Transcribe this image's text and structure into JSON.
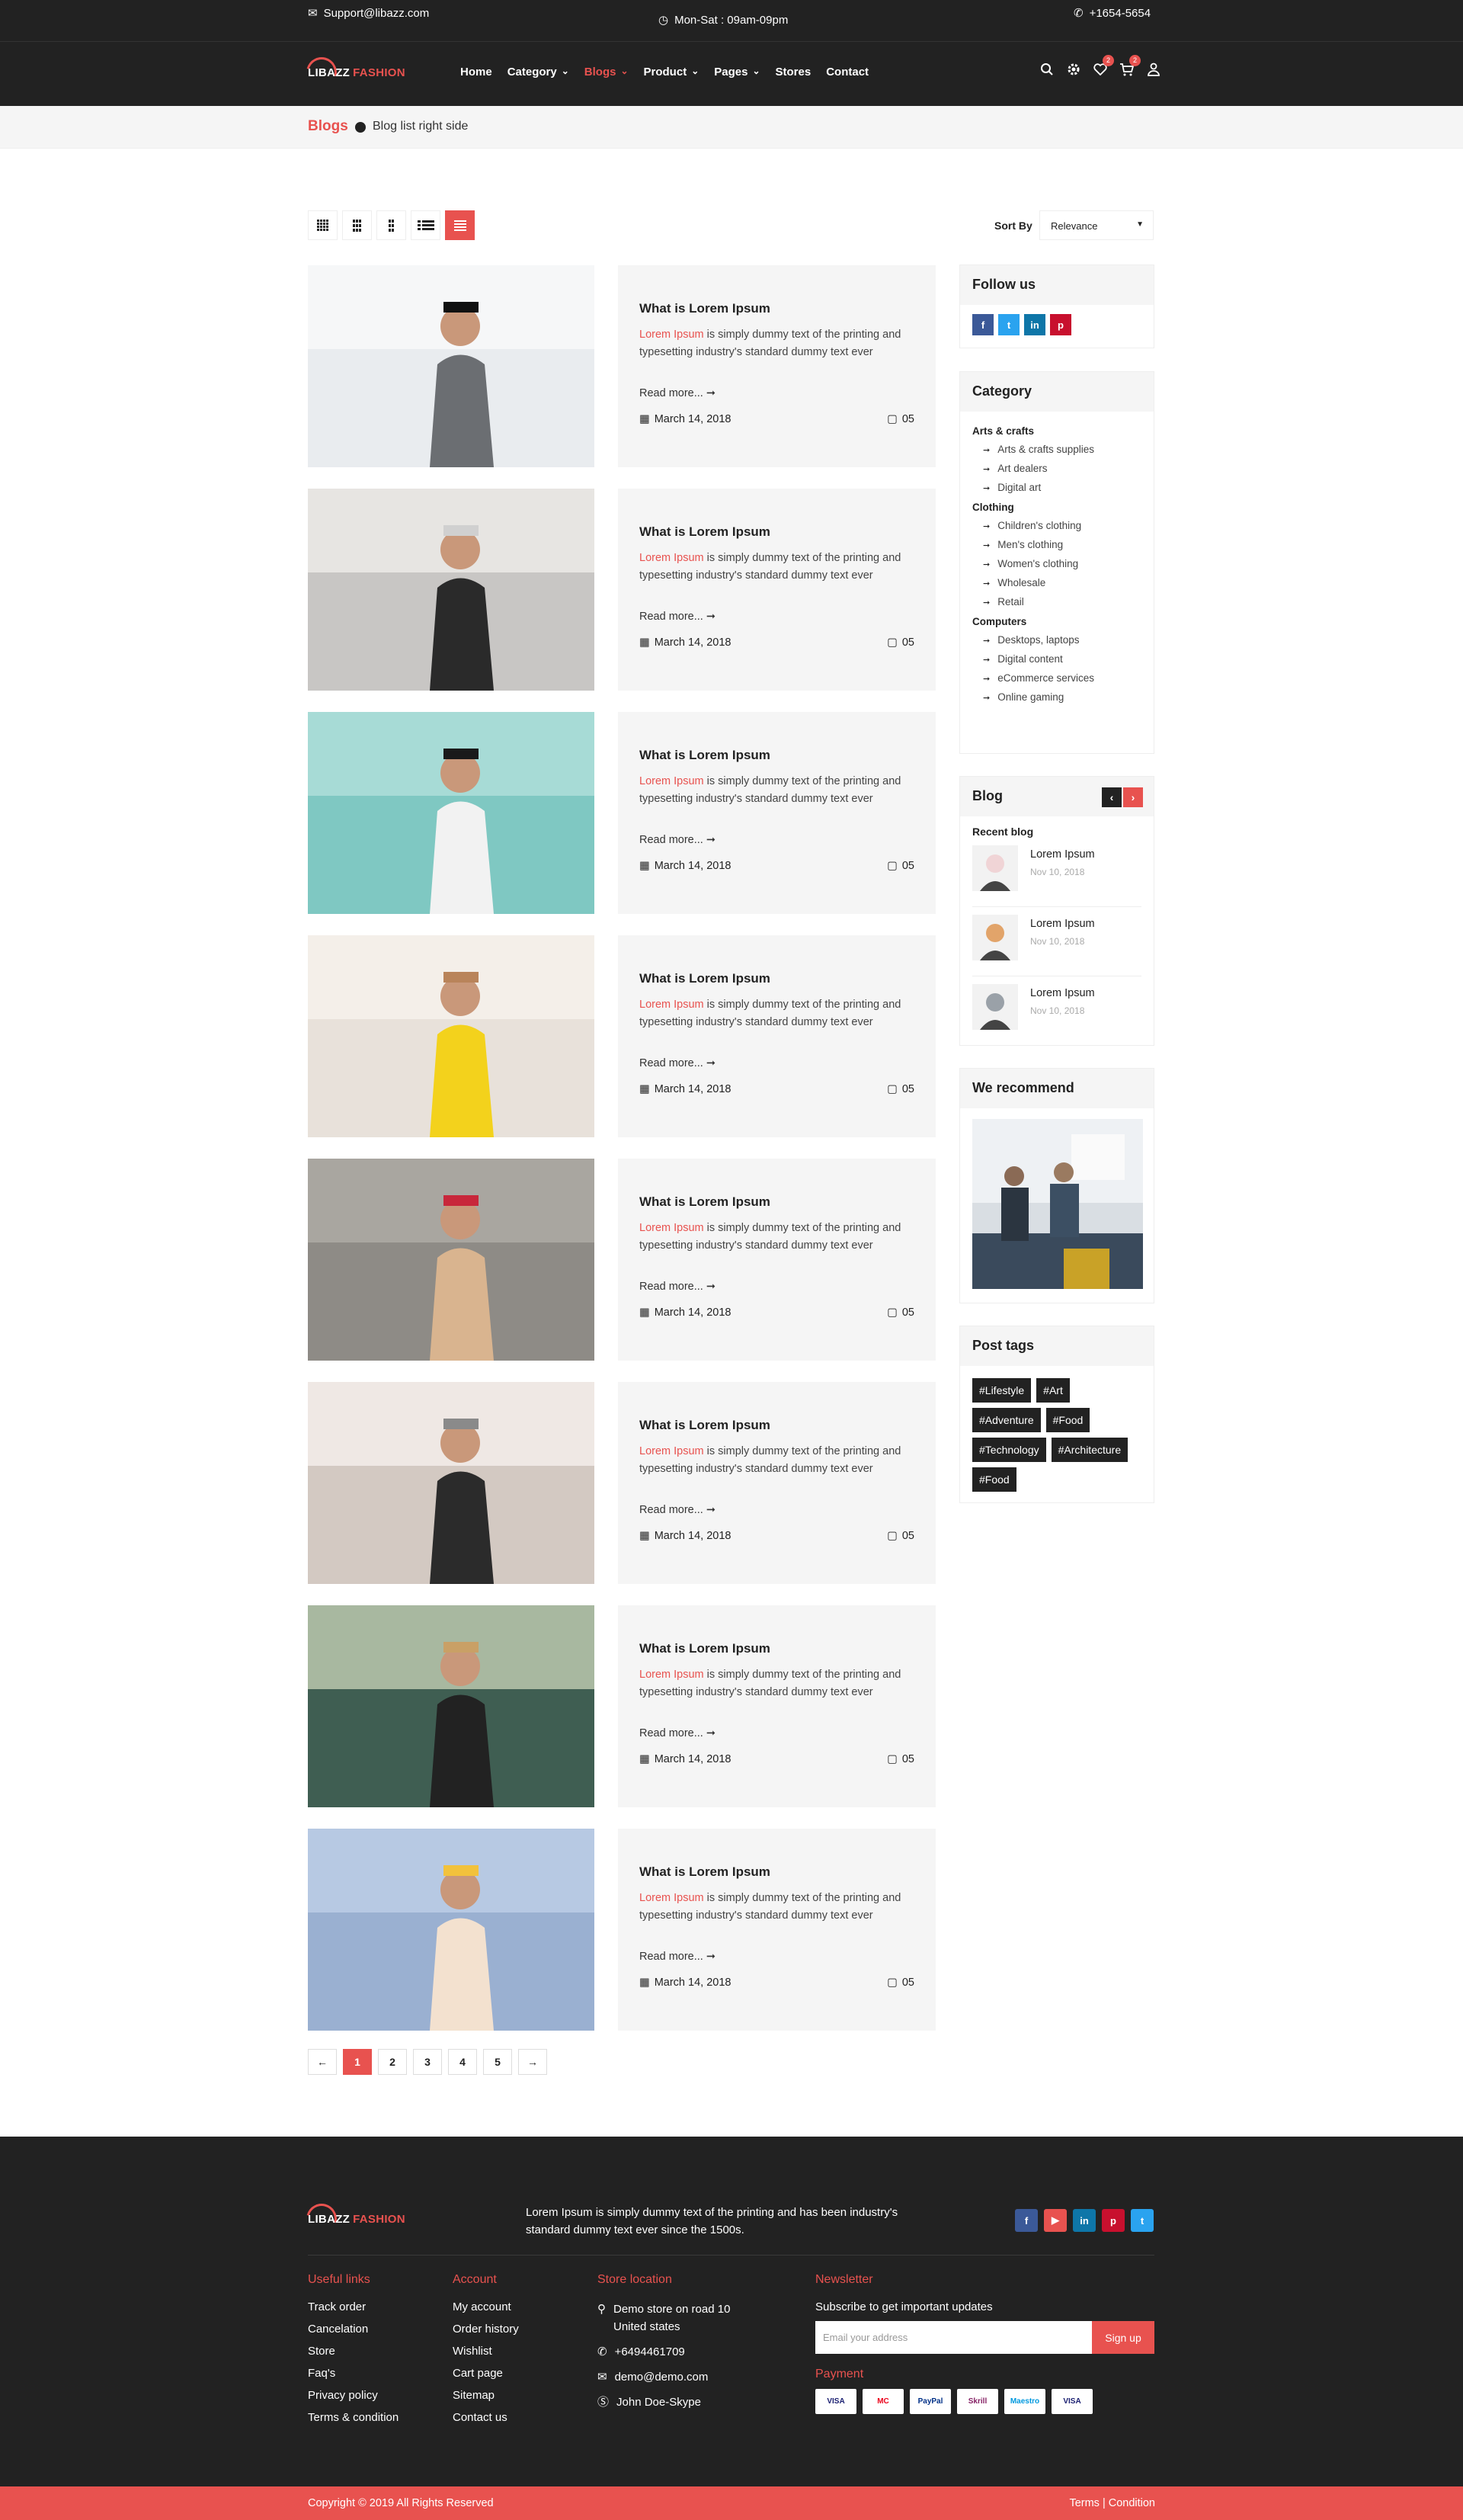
{
  "topbar": {
    "email": "Support@libazz.com",
    "hours": "Mon-Sat : 09am-09pm",
    "phone": "+1654-5654"
  },
  "brand": {
    "part1": "LIBAZZ",
    "part2": "FASHION"
  },
  "menu": [
    "Home",
    "Category",
    "Blogs",
    "Product",
    "Pages",
    "Stores",
    "Contact"
  ],
  "menu_dropdown": [
    "",
    "⌄",
    "⌄",
    "⌄",
    "⌄",
    "",
    ""
  ],
  "icons": {
    "wishlist_count": "2",
    "cart_count": "2"
  },
  "breadcrumb": {
    "section": "Blogs",
    "page": "Blog list right side"
  },
  "toolbar": {
    "sort_label": "Sort By",
    "sort_value": "Relevance"
  },
  "post": {
    "title": "What is Lorem Ipsum",
    "excerpt_hl": "Lorem Ipsum",
    "excerpt_rest": " is simply dummy text of the printing and typesetting industry's standard dummy text ever",
    "read_more": "Read more... ➞",
    "date": "March 14, 2018",
    "comments": "05"
  },
  "posts_count": 8,
  "sidebar": {
    "follow": "Follow us",
    "category": "Category",
    "category_groups": [
      {
        "name": "Arts & crafts",
        "items": [
          "Arts & crafts supplies",
          "Art dealers",
          "Digital art"
        ]
      },
      {
        "name": "Clothing",
        "items": [
          "Children's clothing",
          "Men's clothing",
          "Women's clothing",
          "Wholesale",
          "Retail"
        ]
      },
      {
        "name": "Computers",
        "items": [
          "Desktops, laptops",
          "Digital content",
          "eCommerce services",
          "Online gaming"
        ]
      }
    ],
    "blog": "Blog",
    "recent": "Recent blog",
    "recent_items": [
      {
        "title": "Lorem Ipsum",
        "date": "Nov 10, 2018"
      },
      {
        "title": "Lorem Ipsum",
        "date": "Nov 10, 2018"
      },
      {
        "title": "Lorem Ipsum",
        "date": "Nov 10, 2018"
      }
    ],
    "recommend": "We recommend",
    "tags_title": "Post tags",
    "tags": [
      "#Lifestyle",
      "#Art",
      "#Adventure",
      "#Food",
      "#Technology",
      "#Architecture",
      "#Food"
    ]
  },
  "pagination": [
    "←",
    "1",
    "2",
    "3",
    "4",
    "5",
    "→"
  ],
  "footer": {
    "about": "Lorem Ipsum is simply dummy text of the printing and has been industry's standard dummy text ever since the 1500s.",
    "useful_title": "Useful links",
    "useful": [
      "Track order",
      "Cancelation",
      "Store",
      "Faq's",
      "Privacy policy",
      "Terms & condition"
    ],
    "account_title": "Account",
    "account": [
      "My account",
      "Order history",
      "Wishlist",
      "Cart page",
      "Sitemap",
      "Contact us"
    ],
    "store_title": "Store location",
    "store_address": "Demo store on road 10 United states",
    "store_phone": "+6494461709",
    "store_email": "demo@demo.com",
    "store_skype": "John Doe-Skype",
    "newsletter_title": "Newsletter",
    "newsletter_sub": "Subscribe to get important updates",
    "newsletter_placeholder": "Email your address",
    "newsletter_button": "Sign up",
    "payment_title": "Payment",
    "payments": [
      "VISA",
      "MC",
      "PayPal",
      "Skrill",
      "Maestro",
      "VISA"
    ]
  },
  "copyright": {
    "left": "Copyright © 2019 All Rights Reserved",
    "right": "Terms | Condition"
  },
  "colors": {
    "accent": "#e8524f",
    "dark": "#222222"
  }
}
